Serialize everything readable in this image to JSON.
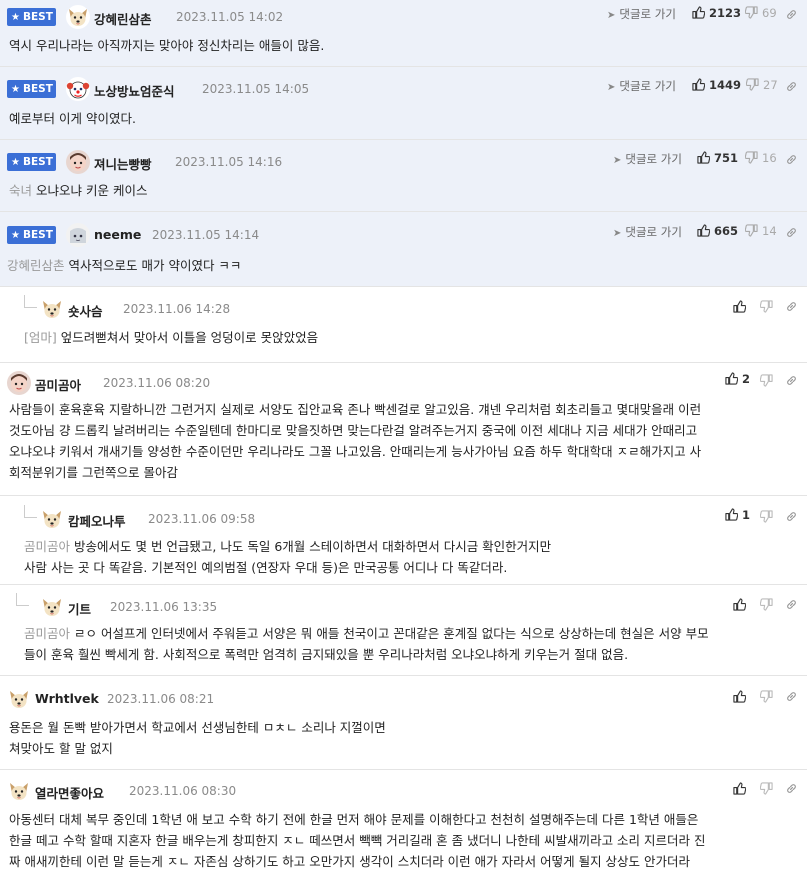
{
  "best_badge": "BEST",
  "reply_to_label": "댓글로 가기",
  "comments": [
    {
      "nick": "강혜린삼촌",
      "date": "2023.11.05 14:02",
      "quote": "",
      "text": "역시 우리나라는 아직까지는 맞아야 정신차리는 애들이 많음.",
      "likes": "2123",
      "dislikes": "69"
    },
    {
      "nick": "노상방뇨엄준식",
      "date": "2023.11.05 14:05",
      "quote": "",
      "text": "예로부터 이게 약이였다.",
      "likes": "1449",
      "dislikes": "27"
    },
    {
      "nick": "져니는빵빵",
      "date": "2023.11.05 14:16",
      "quote": "숙녀",
      "text": "오냐오냐 키운 케이스",
      "likes": "751",
      "dislikes": "16"
    },
    {
      "nick": "neeme",
      "date": "2023.11.05 14:14",
      "quote": "강혜린삼촌",
      "text": "역사적으로도 매가 약이였다 ㅋㅋ",
      "likes": "665",
      "dislikes": "14"
    },
    {
      "nick": "숏사슴",
      "date": "2023.11.06 14:28",
      "quote": "[엄마]",
      "text": "엎드려뻗쳐서 맞아서 이틀을 엉덩이로 못앉았었음",
      "likes": ""
    },
    {
      "nick": "곰미곰아",
      "date": "2023.11.06 08:20",
      "quote": "",
      "lines": [
        "사람들이 훈육훈육 지랄하니깐 그런거지 실제로 서양도 집안교육 존나 빡센걸로 알고있음. 걔넨 우리처럼 회초리들고 몇대맞을래 이런",
        "것도아님 걍 드롭킥 날려버리는 수준일텐데 한마디로 맞을짓하면 맞는다란걸 알려주는거지 중국에 이전 세대나 지금 세대가 안때리고",
        "오냐오냐 키워서 개새기들 양성한 수준이던만 우리나라도 그꼴 나고있음. 안때리는게 능사가아님 요즘 하두 학대학대 ㅈㄹ해가지고 사",
        "회적분위기를 그런쪽으로 몰아감"
      ],
      "likes": "2"
    },
    {
      "nick": "캄페오나투",
      "date": "2023.11.06 09:58",
      "quote": "곰미곰아",
      "lines": [
        "방송에서도 몇 번 언급됐고, 나도 독일 6개월 스테이하면서 대화하면서 다시금 확인한거지만",
        "사람 사는 곳 다 똑같음. 기본적인 예의범절 (연장자 우대 등)은 만국공통 어디나 다 똑같더라."
      ],
      "likes": "1"
    },
    {
      "nick": "기트",
      "date": "2023.11.06 13:35",
      "quote": "곰미곰아",
      "lines": [
        "ㄹㅇ 어설프게 인터넷에서 주워듣고 서양은 뭐 애들 천국이고 꼰대같은 훈계질 없다는 식으로 상상하는데 현실은 서양 부모",
        "들이 훈육 훨씬 빡세게 함. 사회적으로 폭력만 엄격히 금지돼있을 뿐 우리나라처럼 오냐오냐하게 키우는거 절대 없음."
      ],
      "likes": ""
    },
    {
      "nick": "Wrhtlvek",
      "date": "2023.11.06 08:21",
      "quote": "",
      "lines": [
        "용돈은 월 돈빡 받아가면서 학교에서 선생님한테 ㅁㅊㄴ 소리나 지껄이면",
        "쳐맞아도 할 말 없지"
      ],
      "likes": ""
    },
    {
      "nick": "열라면좋아요",
      "date": "2023.11.06 08:30",
      "quote": "",
      "lines": [
        "아동센터 대체 복무 중인데 1학년 애 보고 수학 하기 전에 한글 먼저 해야 문제를 이해한다고 천천히 설명해주는데 다른 1학년 애들은",
        "한글 떼고 수학 할때 지혼자 한글 배우는게 창피한지 ㅈㄴ 떼쓰면서 빽빽 거리길래 혼 좀 냈더니 나한테 씨발새끼라고 소리 지르더라 진",
        "짜 애새끼한테 이런 말 듣는게 ㅈㄴ 자존심 상하기도 하고 오만가지 생각이 스치더라 이런 애가 자라서 어떻게 될지 상상도 안가더라"
      ],
      "likes": ""
    }
  ],
  "colors": {
    "best_badge_bg": "#3b6fd6",
    "best_row_bg": "#edf1f9",
    "quote_text": "#9a9a9a"
  },
  "icons": [
    "star-icon",
    "reply-arrow-icon",
    "thumbs-up-icon",
    "thumbs-down-icon",
    "link-icon",
    "dog-avatar-icon"
  ]
}
